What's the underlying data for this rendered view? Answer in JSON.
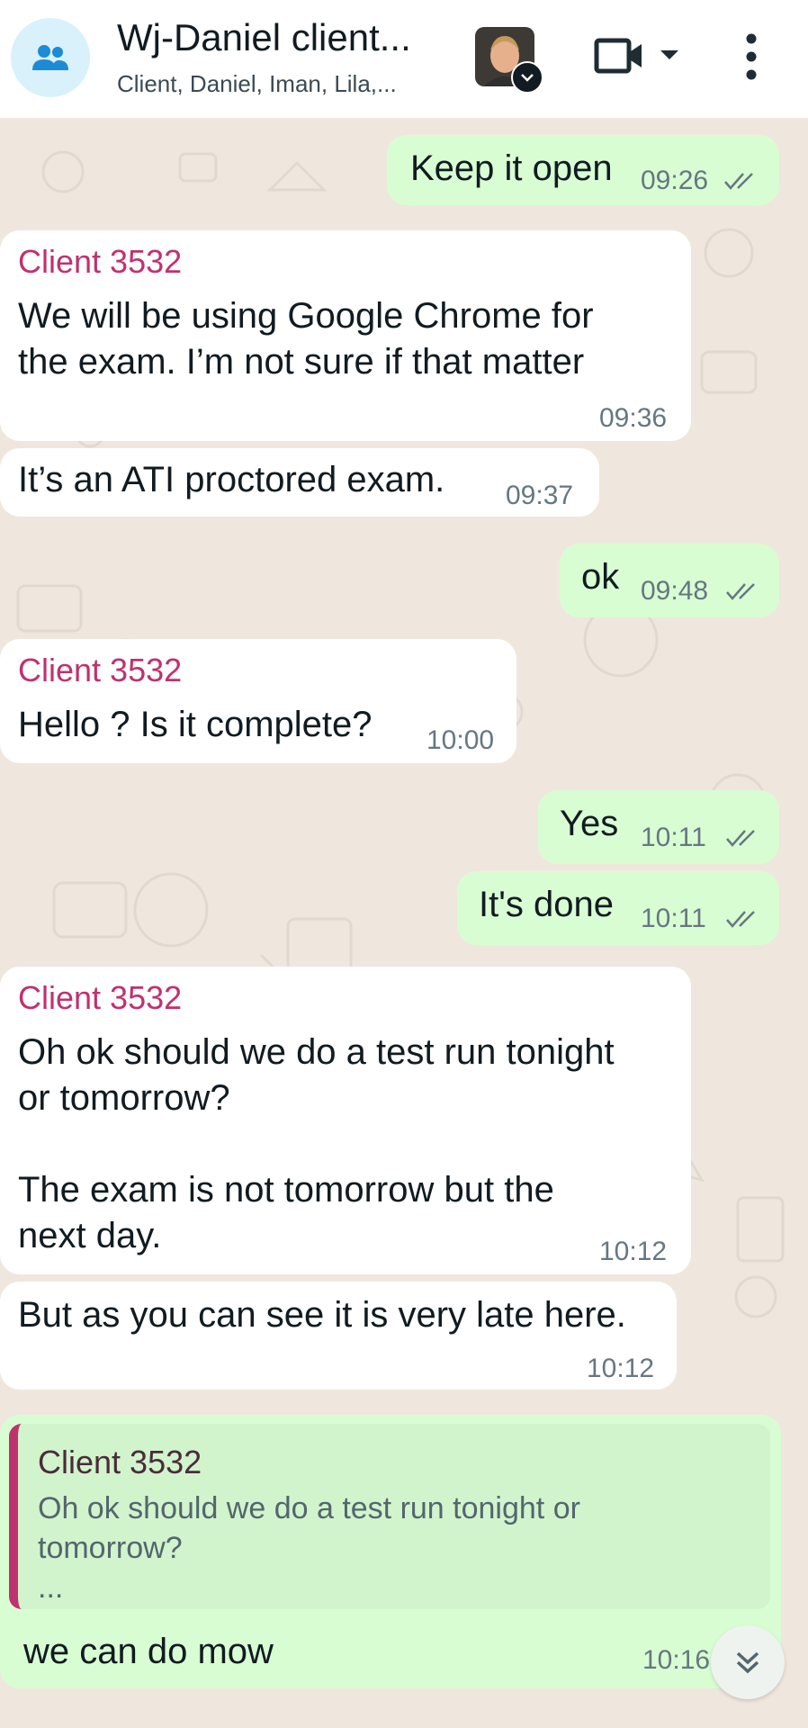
{
  "header": {
    "title": "Wj-Daniel client...",
    "subtitle": "Client, Daniel, Iman, Lila,..."
  },
  "messages": [
    {
      "direction": "out",
      "text": "Keep it open",
      "time": "09:26",
      "read": true
    },
    {
      "direction": "in",
      "sender": "Client 3532",
      "text": "We will be using Google Chrome for\nthe exam. I’m not sure if that matter",
      "time": "09:36"
    },
    {
      "direction": "in",
      "text": "It’s an ATI proctored exam.",
      "time": "09:37"
    },
    {
      "direction": "out",
      "text": "ok",
      "time": "09:48",
      "read": true
    },
    {
      "direction": "in",
      "sender": "Client 3532",
      "text": "Hello ? Is it complete?",
      "time": "10:00"
    },
    {
      "direction": "out",
      "text": "Yes",
      "time": "10:11",
      "read": true
    },
    {
      "direction": "out",
      "text": "It's done",
      "time": "10:11",
      "read": true
    },
    {
      "direction": "in",
      "sender": "Client 3532",
      "text": "Oh ok should we do a test run tonight\nor tomorrow?\n\nThe exam is not tomorrow but the\nnext day.",
      "time": "10:12"
    },
    {
      "direction": "in",
      "text": "But as you can see it is very late here.",
      "time": "10:12"
    },
    {
      "direction": "out",
      "reply": {
        "sender": "Client 3532",
        "text": "Oh ok should we do a test run tonight or tomorrow?",
        "more": "..."
      },
      "text": "we can do mow",
      "time": "10:16"
    }
  ],
  "colors": {
    "outgoing_bubble": "#d9fdd3",
    "incoming_bubble": "#ffffff",
    "sender_name": "#c0316f",
    "read_ticks": "#667781",
    "chat_background": "#efe7dd"
  },
  "icons": [
    "group-icon",
    "video-call-icon",
    "chevron-down-icon",
    "more-vert-icon",
    "double-check-icon",
    "scroll-down-icon"
  ]
}
